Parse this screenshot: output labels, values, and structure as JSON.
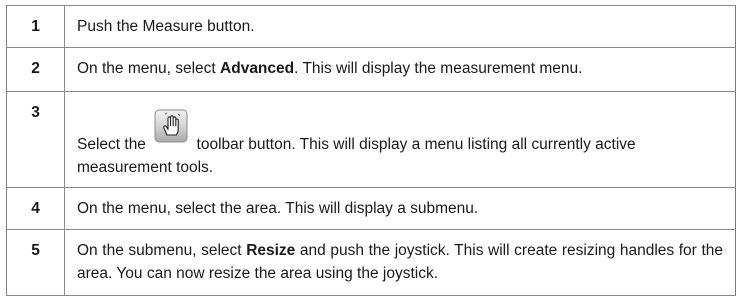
{
  "steps": [
    {
      "number": "1",
      "text": "Push the Measure button."
    },
    {
      "number": "2",
      "text_before": "On the menu, select ",
      "bold": "Advanced",
      "text_after": ". This will display the measurement menu."
    },
    {
      "number": "3",
      "text_before": "Select the ",
      "icon": "hand-cursor-icon",
      "text_after": " toolbar button. This will display a menu listing all currently active measurement tools."
    },
    {
      "number": "4",
      "text": "On the menu, select the area. This will display a submenu."
    },
    {
      "number": "5",
      "text_before": "On the submenu, select ",
      "bold": "Resize",
      "text_after": " and push the joystick. This will create resizing handles for the area. You can now resize the area using the joystick."
    }
  ],
  "colors": {
    "border": "#8a8a8a",
    "text": "#1a1a1a",
    "icon_button_bg": "#c8c8c8"
  }
}
